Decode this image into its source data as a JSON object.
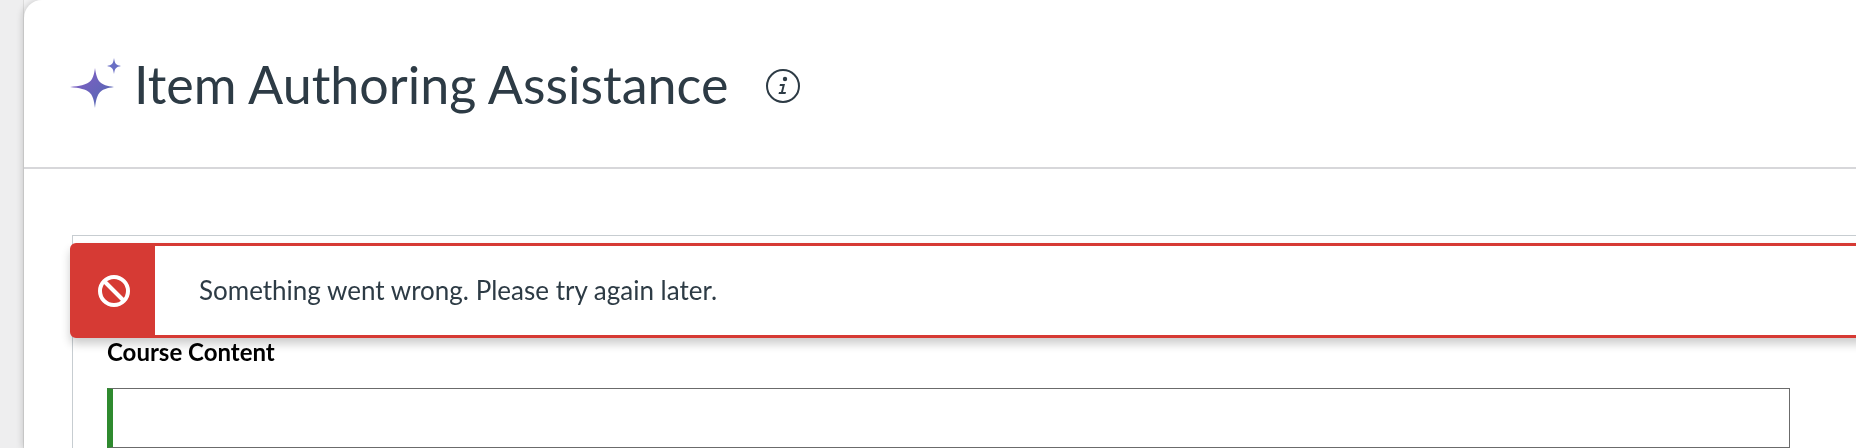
{
  "header": {
    "title": "Item Authoring Assistance"
  },
  "alert": {
    "kind": "error",
    "message": "Something went wrong. Please try again later."
  },
  "section": {
    "heading": "Course Content"
  }
}
